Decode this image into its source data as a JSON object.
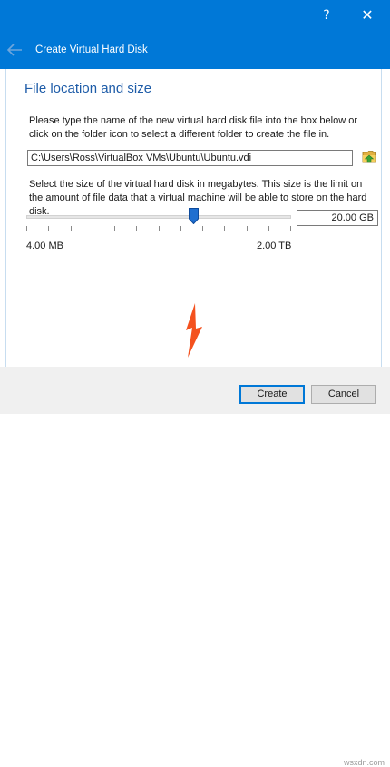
{
  "window": {
    "help_glyph": "?",
    "close_glyph": "✕"
  },
  "header": {
    "title": "Create Virtual Hard Disk",
    "back_icon": "back-arrow-icon"
  },
  "section": {
    "title": "File location and size",
    "description": "Please type the name of the new virtual hard disk file into the box below or click on the folder icon to select a different folder to create the file in.",
    "file_path": "C:\\Users\\Ross\\VirtualBox VMs\\Ubuntu\\Ubuntu.vdi",
    "folder_icon": "folder-icon",
    "size_description": "Select the size of the virtual hard disk in megabytes. This size is the limit on the amount of file data that a virtual machine will be able to store on the hard disk."
  },
  "size": {
    "value": "20.00 GB",
    "min_label": "4.00 MB",
    "max_label": "2.00 TB",
    "slider_fraction": 0.63
  },
  "buttons": {
    "create": "Create",
    "cancel": "Cancel"
  },
  "watermark": "wsxdn.com",
  "colors": {
    "titlebar": "#0078d7",
    "section_title": "#1e5ca8",
    "annotation_arrow": "#f4511e"
  }
}
